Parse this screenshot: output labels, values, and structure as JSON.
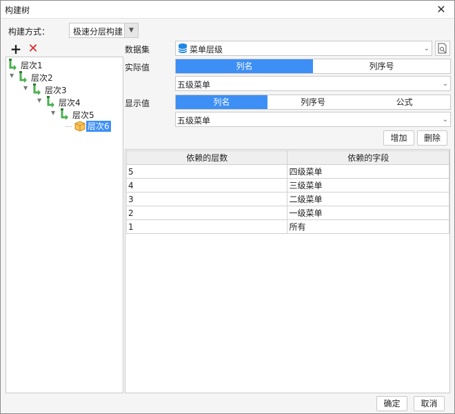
{
  "window": {
    "title": "构建树"
  },
  "build": {
    "label": "构建方式：",
    "value": "极速分层构建"
  },
  "tree": {
    "nodes": [
      {
        "label": "层次1",
        "selected": false
      },
      {
        "label": "层次2",
        "selected": false
      },
      {
        "label": "层次3",
        "selected": false
      },
      {
        "label": "层次4",
        "selected": false
      },
      {
        "label": "层次5",
        "selected": false
      },
      {
        "label": "层次6",
        "selected": true
      }
    ]
  },
  "dataset": {
    "label": "数据集",
    "value": "菜单层级"
  },
  "actual": {
    "label": "实际值",
    "options": [
      "列名",
      "列序号"
    ],
    "active": 0,
    "value": "五级菜单"
  },
  "display": {
    "label": "显示值",
    "options": [
      "列名",
      "列序号",
      "公式"
    ],
    "active": 0,
    "value": "五级菜单"
  },
  "buttons": {
    "add": "增加",
    "delete": "删除",
    "ok": "确定",
    "cancel": "取消"
  },
  "table": {
    "headers": [
      "依赖的层数",
      "依赖的字段"
    ],
    "rows": [
      [
        "5",
        "四级菜单"
      ],
      [
        "4",
        "三级菜单"
      ],
      [
        "3",
        "二级菜单"
      ],
      [
        "2",
        "一级菜单"
      ],
      [
        "1",
        "所有"
      ]
    ]
  },
  "colors": {
    "accent": "#3d8ff5",
    "delete": "#e02222",
    "tree_icon": "#4caf50",
    "db_icon": "#1e88e5"
  }
}
